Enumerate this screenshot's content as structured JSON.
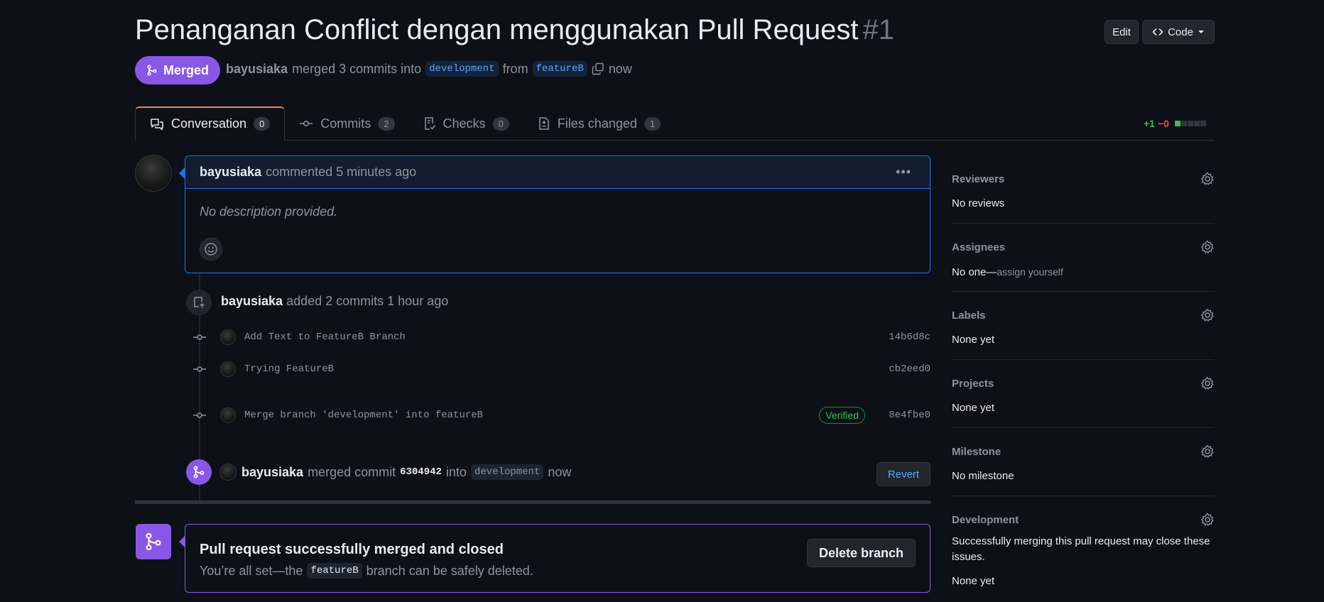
{
  "header": {
    "title": "Penanganan Conflict dengan menggunakan Pull Request",
    "number": "#1",
    "edit_label": "Edit",
    "code_label": "Code",
    "status_label": "Merged",
    "author": "bayusiaka",
    "action": "merged 3 commits into",
    "base_branch": "development",
    "from_word": "from",
    "head_branch": "featureB",
    "time": "now"
  },
  "tabs": [
    {
      "label": "Conversation",
      "count": "0"
    },
    {
      "label": "Commits",
      "count": "2"
    },
    {
      "label": "Checks",
      "count": "0"
    },
    {
      "label": "Files changed",
      "count": "1"
    }
  ],
  "diffstat": {
    "additions": "+1",
    "deletions": "−0"
  },
  "comment": {
    "author": "bayusiaka",
    "meta": "commented 5 minutes ago",
    "body": "No description provided."
  },
  "commits_event": {
    "author": "bayusiaka",
    "meta": "added 2 commits 1 hour ago"
  },
  "commits": [
    {
      "message": "Add Text to FeatureB Branch",
      "sha": "14b6d8c"
    },
    {
      "message": "Trying FeatureB",
      "sha": "cb2eed0"
    },
    {
      "message": "Merge branch 'development' into featureB",
      "sha": "8e4fbe0",
      "badge": "Verified"
    }
  ],
  "merge_event": {
    "author": "bayusiaka",
    "action": "merged commit",
    "sha": "6304942",
    "into": "into",
    "branch": "development",
    "time": "now",
    "revert_label": "Revert"
  },
  "status": {
    "title": "Pull request successfully merged and closed",
    "sub_before": "You’re all set—the",
    "branch": "featureB",
    "sub_after": "branch can be safely deleted.",
    "delete_label": "Delete branch"
  },
  "sidebar": {
    "reviewers": {
      "title": "Reviewers",
      "value": "No reviews"
    },
    "assignees": {
      "title": "Assignees",
      "value": "No one—",
      "link": "assign yourself"
    },
    "labels": {
      "title": "Labels",
      "value": "None yet"
    },
    "projects": {
      "title": "Projects",
      "value": "None yet"
    },
    "milestone": {
      "title": "Milestone",
      "value": "No milestone"
    },
    "development": {
      "title": "Development",
      "desc": "Successfully merging this pull request may close these issues.",
      "value": "None yet"
    }
  },
  "colors": {
    "merged": "#8957e5",
    "accent": "#1f6feb",
    "link": "#58a6ff",
    "success": "#3fb950",
    "danger": "#f85149"
  }
}
